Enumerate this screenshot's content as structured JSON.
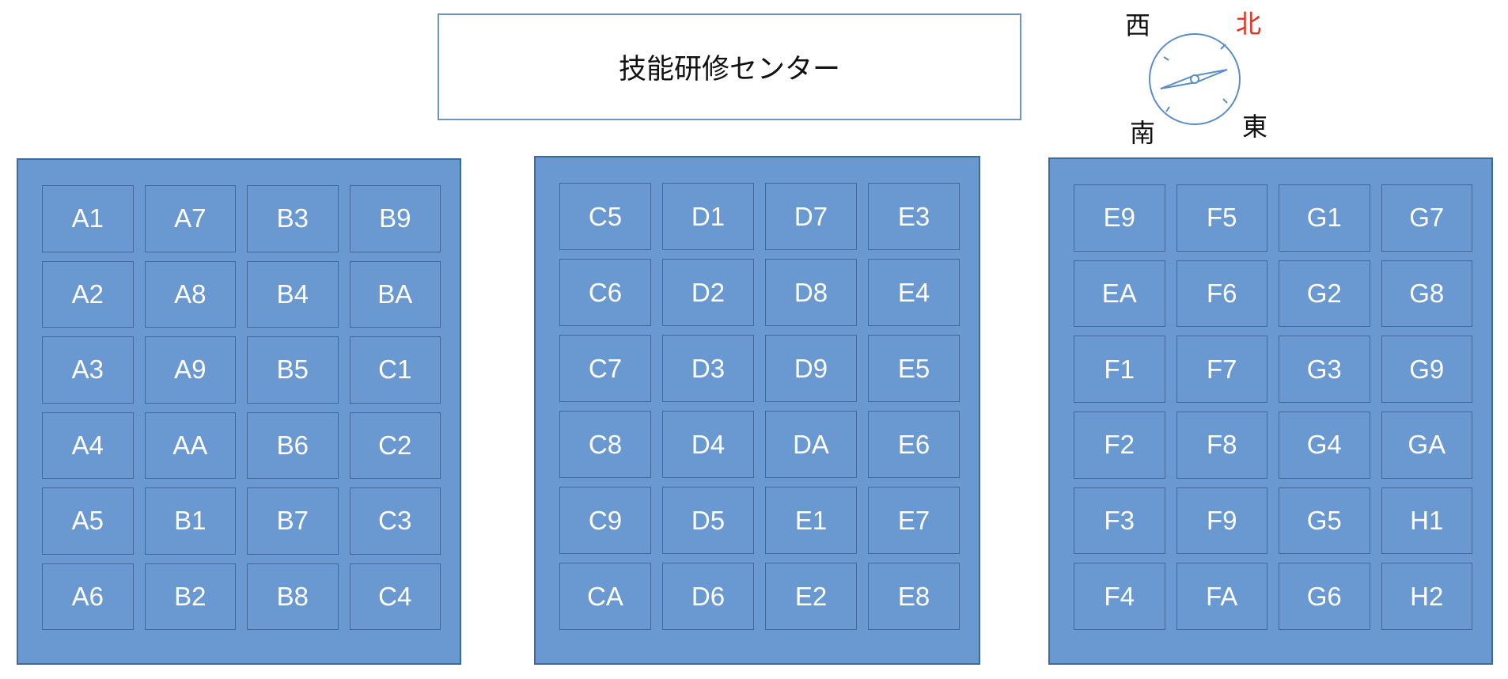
{
  "title": "技能研修センター",
  "compass": {
    "north": "北",
    "south": "南",
    "east": "東",
    "west": "西",
    "north_color": "#e0301e"
  },
  "colors": {
    "block_fill": "#6a98d0",
    "block_border": "#3f6aa0",
    "room_text": "#ffffff"
  },
  "blocks": [
    {
      "rows": [
        [
          "A1",
          "A7",
          "B3",
          "B9"
        ],
        [
          "A2",
          "A8",
          "B4",
          "BA"
        ],
        [
          "A3",
          "A9",
          "B5",
          "C1"
        ],
        [
          "A4",
          "AA",
          "B6",
          "C2"
        ],
        [
          "A5",
          "B1",
          "B7",
          "C3"
        ],
        [
          "A6",
          "B2",
          "B8",
          "C4"
        ]
      ]
    },
    {
      "rows": [
        [
          "C5",
          "D1",
          "D7",
          "E3"
        ],
        [
          "C6",
          "D2",
          "D8",
          "E4"
        ],
        [
          "C7",
          "D3",
          "D9",
          "E5"
        ],
        [
          "C8",
          "D4",
          "DA",
          "E6"
        ],
        [
          "C9",
          "D5",
          "E1",
          "E7"
        ],
        [
          "CA",
          "D6",
          "E2",
          "E8"
        ]
      ]
    },
    {
      "rows": [
        [
          "E9",
          "F5",
          "G1",
          "G7"
        ],
        [
          "EA",
          "F6",
          "G2",
          "G8"
        ],
        [
          "F1",
          "F7",
          "G3",
          "G9"
        ],
        [
          "F2",
          "F8",
          "G4",
          "GA"
        ],
        [
          "F3",
          "F9",
          "G5",
          "H1"
        ],
        [
          "F4",
          "FA",
          "G6",
          "H2"
        ]
      ]
    }
  ]
}
